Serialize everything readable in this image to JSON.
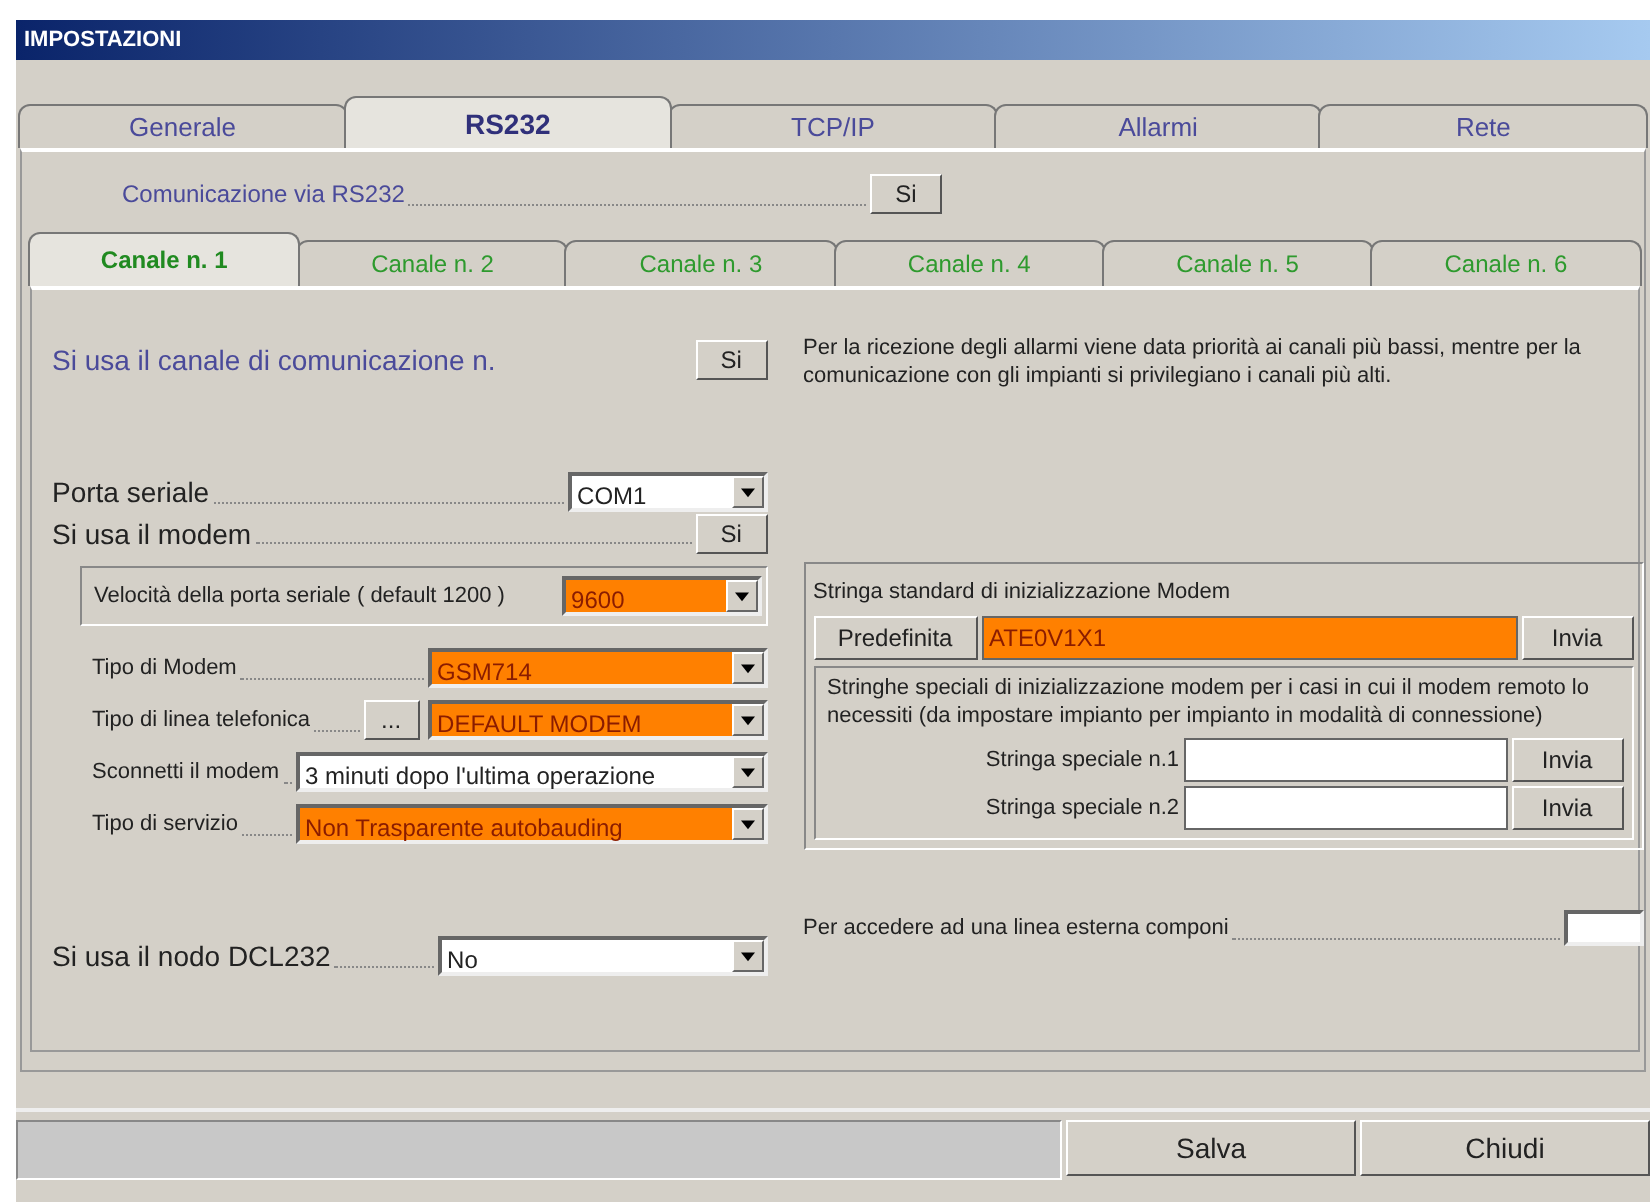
{
  "window": {
    "title": "IMPOSTAZIONI"
  },
  "tabs": [
    {
      "label": "Generale",
      "selected": false
    },
    {
      "label": "RS232",
      "selected": true
    },
    {
      "label": "TCP/IP",
      "selected": false
    },
    {
      "label": "Allarmi",
      "selected": false
    },
    {
      "label": "Rete",
      "selected": false
    }
  ],
  "rs232": {
    "label": "Comunicazione via RS232",
    "button": "Si"
  },
  "channel_tabs": [
    {
      "label": "Canale n. 1",
      "selected": true
    },
    {
      "label": "Canale n. 2",
      "selected": false
    },
    {
      "label": "Canale n. 3",
      "selected": false
    },
    {
      "label": "Canale n. 4",
      "selected": false
    },
    {
      "label": "Canale n. 5",
      "selected": false
    },
    {
      "label": "Canale n. 6",
      "selected": false
    }
  ],
  "channel": {
    "enabled": {
      "label": "Si usa il canale di comunicazione n.",
      "button": "Si"
    },
    "note": "Per la ricezione degli allarmi viene data priorità ai canali più bassi, mentre per la comunicazione con gli impianti si privilegiano i canali più alti.",
    "serial_port": {
      "label": "Porta seriale",
      "value": "COM1",
      "highlighted": false
    },
    "modem": {
      "label": "Si usa il modem",
      "button": "Si"
    },
    "speed": {
      "label": "Velocità della porta seriale ( default 1200 )",
      "value": "9600",
      "highlighted": true
    },
    "modem_settings": [
      {
        "kind": "combo",
        "label": "Tipo di Modem",
        "value": "GSM714",
        "highlighted": true
      },
      {
        "kind": "combo-with-button",
        "label": "Tipo di linea telefonica",
        "button": "...",
        "value": "DEFAULT MODEM",
        "highlighted": true
      },
      {
        "kind": "combo-wide",
        "label": "Sconnetti il modem",
        "value": "3 minuti  dopo l'ultima operazione",
        "highlighted": false
      },
      {
        "kind": "combo-wide",
        "label": "Tipo di servizio",
        "value": "Non Trasparente autobauding",
        "highlighted": true
      }
    ],
    "init_strings": {
      "title": "Stringa standard di inizializzazione Modem",
      "default_button": "Predefinita",
      "default_value": "ATE0V1X1",
      "highlighted": true,
      "send_button": "Invia",
      "special_note": "Stringhe speciali di inizializzazione modem per i casi in cui il modem remoto lo necessiti (da impostare impianto per impianto in modalità di connessione)",
      "special": [
        {
          "label": "Stringa speciale n.1",
          "button": "Invia"
        },
        {
          "label": "Stringa speciale n.2",
          "button": "Invia"
        }
      ]
    },
    "dcl232": {
      "label": "Si usa il nodo DCL232",
      "value": "No",
      "highlighted": false
    },
    "external_line": {
      "label": "Per accedere ad una linea esterna componi"
    }
  },
  "buttons": [
    "Salva",
    "Chiudi"
  ]
}
